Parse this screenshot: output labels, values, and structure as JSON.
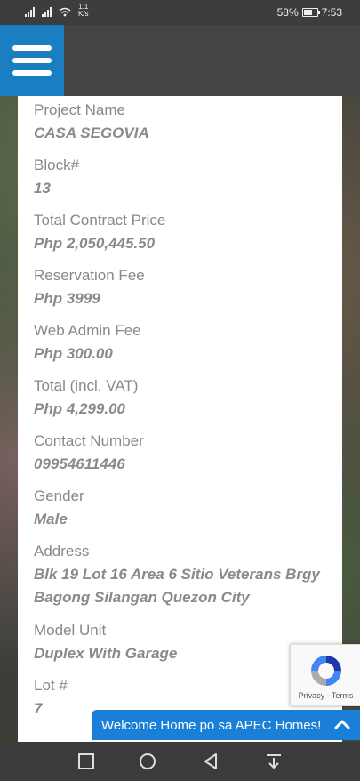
{
  "status_bar": {
    "network_speed": "1.1\nK/s",
    "speed_value": "1.1",
    "speed_unit": "K/s",
    "battery": "58%",
    "time": "7:53"
  },
  "header": {
    "menu_icon": "hamburger-menu-icon"
  },
  "fields": [
    {
      "label": "Project Name",
      "value": "CASA SEGOVIA"
    },
    {
      "label": "Block#",
      "value": "13"
    },
    {
      "label": "Total Contract Price",
      "value": "Php 2,050,445.50"
    },
    {
      "label": "Reservation Fee",
      "value": "Php 3999"
    },
    {
      "label": "Web Admin Fee",
      "value": "Php 300.00"
    },
    {
      "label": "Total (incl. VAT)",
      "value": "Php 4,299.00"
    },
    {
      "label": "Contact Number",
      "value": "09954611446"
    },
    {
      "label": "Gender",
      "value": "Male"
    },
    {
      "label": "Address",
      "value_lines": [
        "Blk 19 Lot 16 Area 6 Sitio Veterans Brgy",
        "Bagong Silangan Quezon City"
      ]
    },
    {
      "label": "Model Unit",
      "value": "Duplex With Garage"
    },
    {
      "label": "Lot #",
      "value": "7"
    }
  ],
  "recaptcha": {
    "terms": "Privacy - Terms"
  },
  "chat": {
    "label": "Welcome Home po sa APEC Homes!"
  },
  "colors": {
    "accent": "#1a7fc2",
    "chat": "#1a7fd6",
    "header": "#444444"
  }
}
